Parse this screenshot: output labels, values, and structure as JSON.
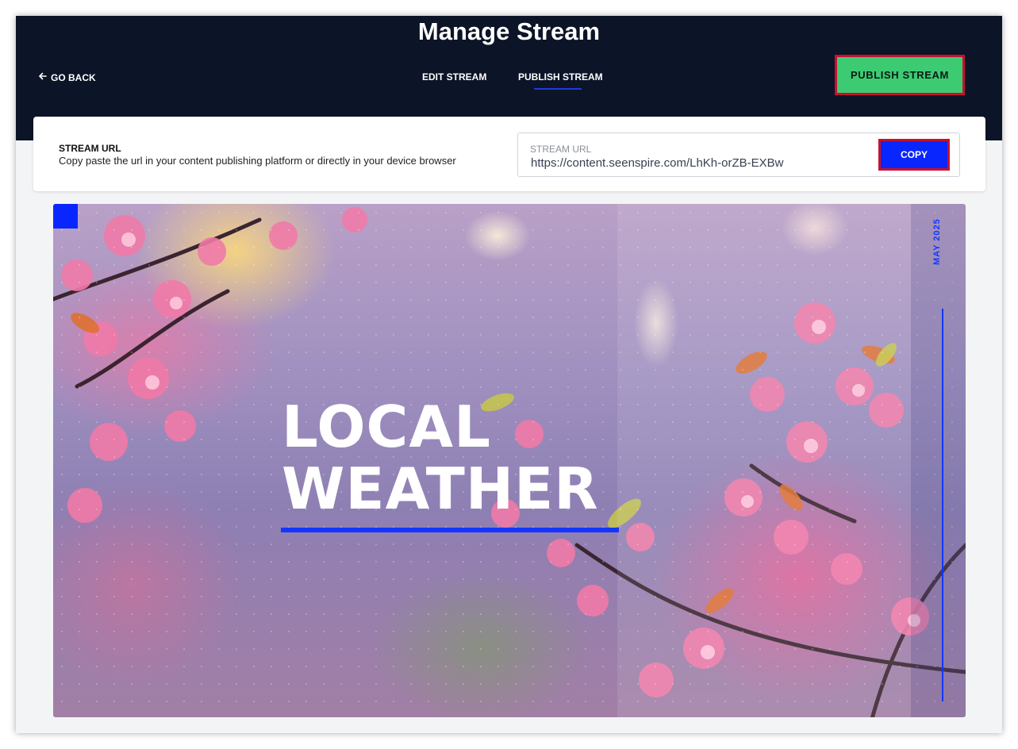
{
  "header": {
    "title": "Manage Stream",
    "go_back": "GO BACK",
    "tabs": [
      {
        "label": "EDIT STREAM",
        "active": false
      },
      {
        "label": "PUBLISH STREAM",
        "active": true
      }
    ],
    "publish_button": "PUBLISH STREAM"
  },
  "stream_url_card": {
    "title": "STREAM URL",
    "description": "Copy paste the url in your content publishing platform or directly in your device browser",
    "field_label": "STREAM URL",
    "field_value": "https://content.seenspire.com/LhKh-orZB-EXBw",
    "copy_button": "COPY"
  },
  "preview": {
    "headline_line1": "LOCAL",
    "headline_line2": "WEATHER",
    "date": "MAY 2025"
  },
  "colors": {
    "topbar": "#0c1427",
    "publish_green": "#3ccb73",
    "copy_blue": "#0a26ff",
    "highlight_red": "#c8102e",
    "accent_blue": "#1236ff"
  },
  "icons": {
    "go_back": "arrow-left-icon"
  }
}
